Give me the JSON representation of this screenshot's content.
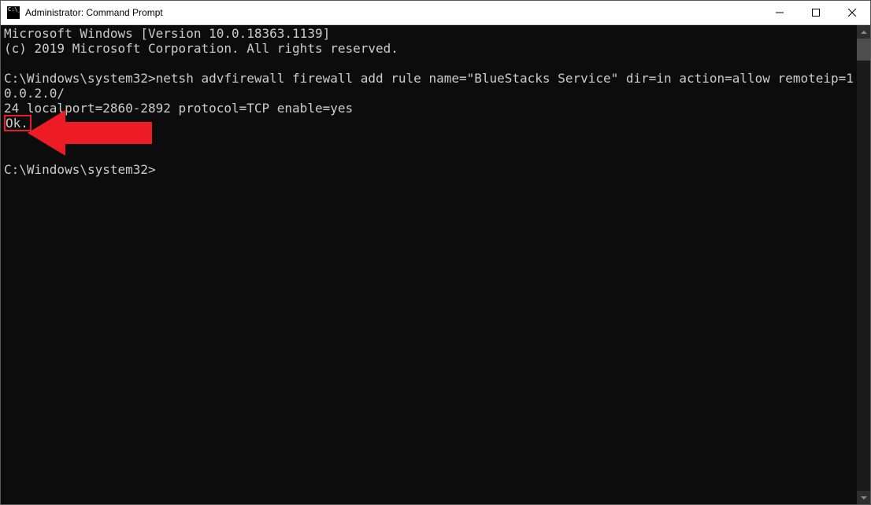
{
  "window": {
    "title": "Administrator: Command Prompt"
  },
  "terminal": {
    "line1": "Microsoft Windows [Version 10.0.18363.1139]",
    "line2": "(c) 2019 Microsoft Corporation. All rights reserved.",
    "blank1": "",
    "prompt1": "C:\\Windows\\system32>",
    "command_part1": "netsh advfirewall firewall add rule name=\"BlueStacks Service\" dir=in action=allow remoteip=10.0.2.0/",
    "command_part2": "24 localport=2860-2892 protocol=TCP enable=yes",
    "ok": "Ok.",
    "blank2": "",
    "blank3": "",
    "prompt2": "C:\\Windows\\system32>"
  },
  "annotation": {
    "arrow_color": "#ed1c24"
  }
}
